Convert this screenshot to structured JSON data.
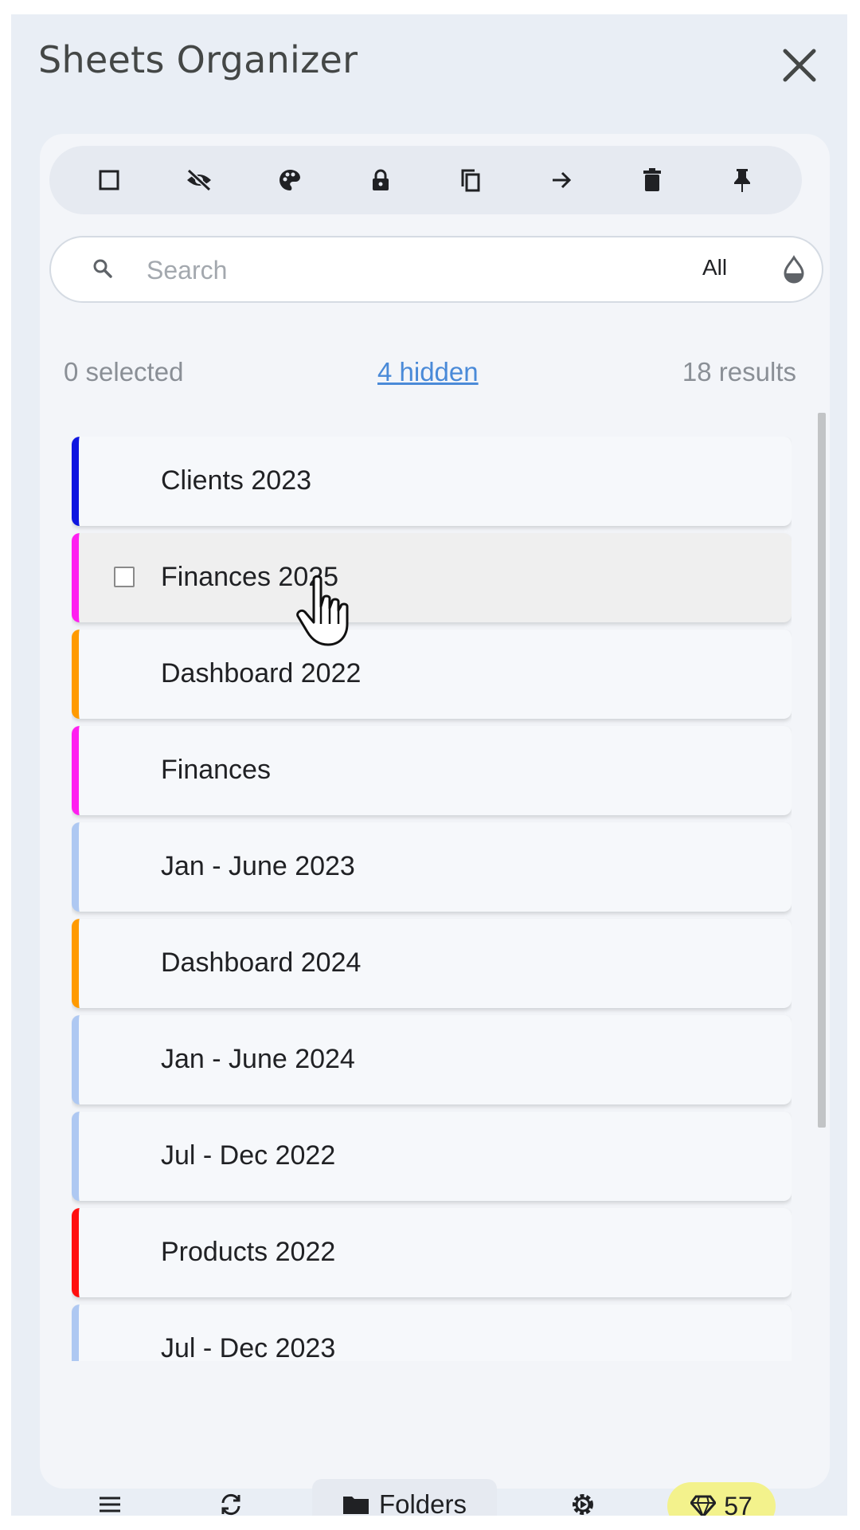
{
  "app": {
    "title": "Sheets Organizer"
  },
  "toolbar": {
    "icons": [
      "checkbox-icon",
      "hide-icon",
      "palette-icon",
      "lock-icon",
      "copy-icon",
      "arrow-right-icon",
      "trash-icon",
      "pin-icon"
    ]
  },
  "search": {
    "placeholder": "Search",
    "value": "",
    "filter_label": "All"
  },
  "stats": {
    "selected": "0 selected",
    "hidden": "4 hidden",
    "results": "18 results"
  },
  "sheets": [
    {
      "label": "Clients 2023",
      "color": "#0f16e0"
    },
    {
      "label": "Finances 2025",
      "color": "#ff1ff0",
      "hovered": true
    },
    {
      "label": "Dashboard 2022",
      "color": "#ff9a00"
    },
    {
      "label": "Finances",
      "color": "#ff1ff0"
    },
    {
      "label": "Jan - June 2023",
      "color": "#aec8f2"
    },
    {
      "label": "Dashboard 2024",
      "color": "#ff9a00"
    },
    {
      "label": "Jan - June 2024",
      "color": "#aec8f2"
    },
    {
      "label": "Jul - Dec 2022",
      "color": "#aec8f2"
    },
    {
      "label": "Products 2022",
      "color": "#ff0f0f"
    },
    {
      "label": "Jul - Dec 2023",
      "color": "#aec8f2"
    },
    {
      "label": "",
      "color": "#ff0f0f"
    }
  ],
  "bottom_nav": {
    "folders_label": "Folders",
    "badge_count": "57"
  }
}
